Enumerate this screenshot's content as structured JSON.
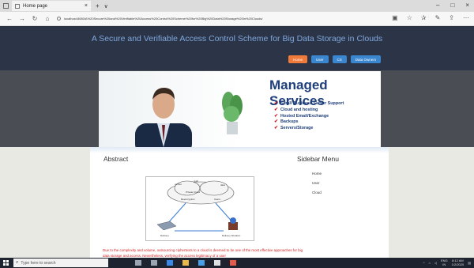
{
  "browser": {
    "tab_title": "Home page",
    "tab_close": "×",
    "new_tab": "+",
    "tab_menu": "∨",
    "url": "localhost:8080/A%20Secure%20and%20Verifiable%20Access%20Control%20Scheme%20for%20Big%20Data%20Storage%20in%20Clouds/",
    "window_controls": [
      "–",
      "□",
      "×"
    ],
    "nav": [
      "←",
      "→",
      "↻",
      "⌂"
    ],
    "toolbar_icons": [
      "▣",
      "☆",
      "✰",
      "✎",
      "⇪",
      "⋯"
    ]
  },
  "site": {
    "title": "A Secure and Verifiable Access Control Scheme for Big Data Storage in Clouds",
    "menu": [
      {
        "label": "Home",
        "active": true
      },
      {
        "label": "User",
        "active": false
      },
      {
        "label": "CS",
        "active": false
      },
      {
        "label": "Data Owners",
        "active": false
      }
    ]
  },
  "banner": {
    "heading": "Managed Services",
    "items": [
      "Small Business Server Support",
      "Cloud and hosting",
      "Hosted Email/Exchange",
      "Backups",
      "Servers/Storage"
    ]
  },
  "main": {
    "abstract_heading": "Abstract",
    "abstract_text": "Due to the complexity and volume, outsourcing ciphertexts to a cloud is deemed to be one of the most effective approaches for big data storage and access. Nevertheless, verifying the access legitimacy of a user",
    "diagram": {
      "cloud_label": "Private Cloud",
      "node_labels": [
        "verifier",
        "Auth",
        "data",
        "Reencryption",
        "Users"
      ],
      "left_label": "Delivery",
      "right_label": "Delivery Situation"
    }
  },
  "sidebar": {
    "heading": "Sidebar Menu",
    "items": [
      "Home",
      "User",
      "Cloud"
    ]
  },
  "taskbar": {
    "search_placeholder": "Type here to search",
    "tray_lang": "ENG",
    "tray_region": "IN",
    "time": "8:12 AM",
    "date": "1/2/2020"
  },
  "colors": {
    "header_bg": "#2c3447",
    "title": "#7ea7dc",
    "active_menu": "#f07a3a",
    "menu": "#3a86cf",
    "banner_text": "#1f3f7a",
    "abstract_text": "#d42020"
  }
}
